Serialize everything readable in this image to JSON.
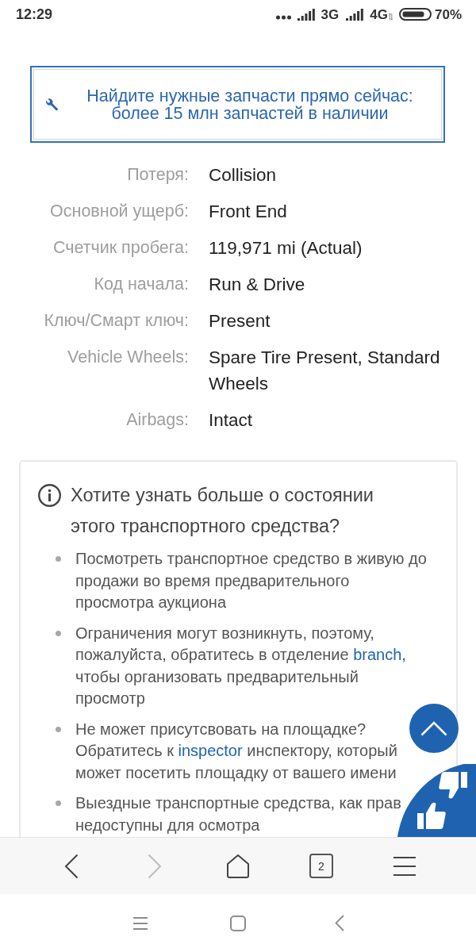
{
  "status_bar": {
    "time": "12:29",
    "networks": [
      {
        "label": "3G"
      },
      {
        "label": "4G"
      }
    ],
    "battery": "70%"
  },
  "banner": {
    "text": "Найдите нужные запчасти прямо сейчас: более 15 млн запчастей в наличии"
  },
  "details": [
    {
      "label": "Потеря:",
      "value": "Collision"
    },
    {
      "label": "Основной ущерб:",
      "value": "Front End"
    },
    {
      "label": "Счетчик пробега:",
      "value": "119,971 mi (Actual)"
    },
    {
      "label": "Код начала:",
      "value": "Run & Drive"
    },
    {
      "label": "Ключ/Смарт ключ:",
      "value": "Present"
    },
    {
      "label": "Vehicle Wheels:",
      "value": "Spare Tire Present, Standard Wheels"
    },
    {
      "label": "Airbags:",
      "value": "Intact"
    }
  ],
  "info_card": {
    "title": "Хотите узнать больше о состоянии этого транспортного средства?",
    "items": [
      {
        "parts": [
          {
            "kind": "text",
            "text": "Посмотреть транспортное средство в живую до продажи во время предварительного просмотра аукциона"
          }
        ]
      },
      {
        "parts": [
          {
            "kind": "text",
            "text": "Ограничения могут возникнуть, поэтому, пожалуйста, обратитесь в отделение "
          },
          {
            "kind": "link",
            "text": "branch"
          },
          {
            "kind": "text",
            "text": ", чтобы организовать предварительный просмотр"
          }
        ]
      },
      {
        "parts": [
          {
            "kind": "text",
            "text": "Не может присутсвовать на площадке? Обратитесь к "
          },
          {
            "kind": "link",
            "text": "inspector"
          },
          {
            "kind": "text",
            "text": " инспектору, который может посетить площадку от вашего имени"
          }
        ]
      },
      {
        "parts": [
          {
            "kind": "text",
            "text": "Выездные транспортные средства, как прав недоступны для осмотра"
          }
        ]
      }
    ]
  },
  "browser_toolbar": {
    "buttons": [
      {
        "kind": "back",
        "disabled": false
      },
      {
        "kind": "forward",
        "disabled": true
      },
      {
        "kind": "home",
        "disabled": false
      },
      {
        "kind": "tabs",
        "count": "2",
        "disabled": false
      },
      {
        "kind": "menu",
        "disabled": false
      }
    ]
  }
}
